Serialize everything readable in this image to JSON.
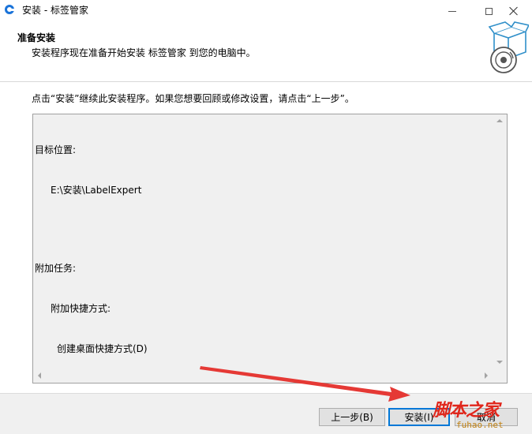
{
  "window": {
    "title": "安装 - 标签管家",
    "icon": "installer-app-icon"
  },
  "header": {
    "heading": "准备安装",
    "subheading": "安装程序现在准备开始安装 标签管家 到您的电脑中。",
    "graphic_icon": "box-with-disc-icon"
  },
  "content": {
    "instruction": "点击“安装”继续此安装程序。如果您想要回顾或修改设置，请点击“上一步”。",
    "memo": {
      "dest_label": "目标位置:",
      "dest_value": "E:\\安装\\LabelExpert",
      "tasks_label": "附加任务:",
      "shortcut_label": "附加快捷方式:",
      "shortcut_value": "创建桌面快捷方式(D)"
    }
  },
  "buttons": {
    "back": "上一步(B)",
    "install": "安装(I)",
    "cancel": "取消"
  },
  "watermark": {
    "main": "脚本之家",
    "sub": "fuhao.net"
  },
  "colors": {
    "accent": "#0078d7",
    "annotation_arrow": "#e53935",
    "watermark": "#e0261b"
  }
}
